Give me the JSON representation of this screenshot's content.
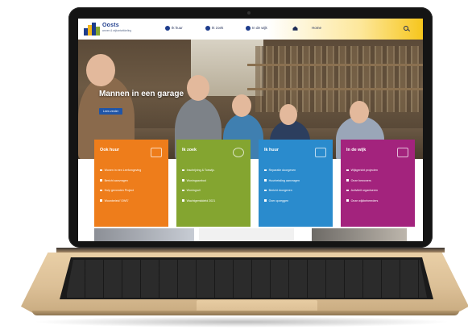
{
  "nav": {
    "brand": "Oosts",
    "brand_sub": "wonen & wijkontwikkeling",
    "items": [
      {
        "label": "Ik huur",
        "icon": "house-icon"
      },
      {
        "label": "Ik zoek",
        "icon": "search-circle-icon"
      },
      {
        "label": "In de wijk",
        "icon": "people-icon"
      },
      {
        "label": "Home",
        "icon": "home-icon"
      }
    ],
    "search_icon": "search-icon"
  },
  "hero": {
    "title": "Mannen in een garage",
    "button_label": "Lees verder"
  },
  "tiles": [
    {
      "title": "Ook huur",
      "color": "#ee7d1b",
      "icon": "arrow-right-icon",
      "items": [
        "Wonen in een Leefomgeving",
        "Bericht aanvragen",
        "Hulp gevonden Project",
        "Woonbeleid 'OWS'"
      ]
    },
    {
      "title": "Ik zoek",
      "color": "#84a530",
      "icon": "compass-icon",
      "items": [
        "Inschrijving & Toewijz.",
        "Woningaanbod",
        "Woningruil",
        "Wachtgemiddeld 2021"
      ]
    },
    {
      "title": "Ik huur",
      "color": "#2a8bcd",
      "icon": "house-icon",
      "items": [
        "Reparatie doorgeven",
        "Huurbetaling aanvragen",
        "Bericht doorgeven",
        "Over opzeggen"
      ]
    },
    {
      "title": "In de wijk",
      "color": "#a3237d",
      "icon": "people-icon",
      "items": [
        "Wijkgericht projecten",
        "Onze bewoners",
        "Activiteit organiseren",
        "Onze wijkbeheerders"
      ]
    }
  ],
  "colors": {
    "brand": "#1d3c8c",
    "nav_gradient_end": "#f6c61d",
    "hero_button": "#1f55a8",
    "laptop_body": "#dcc097"
  }
}
